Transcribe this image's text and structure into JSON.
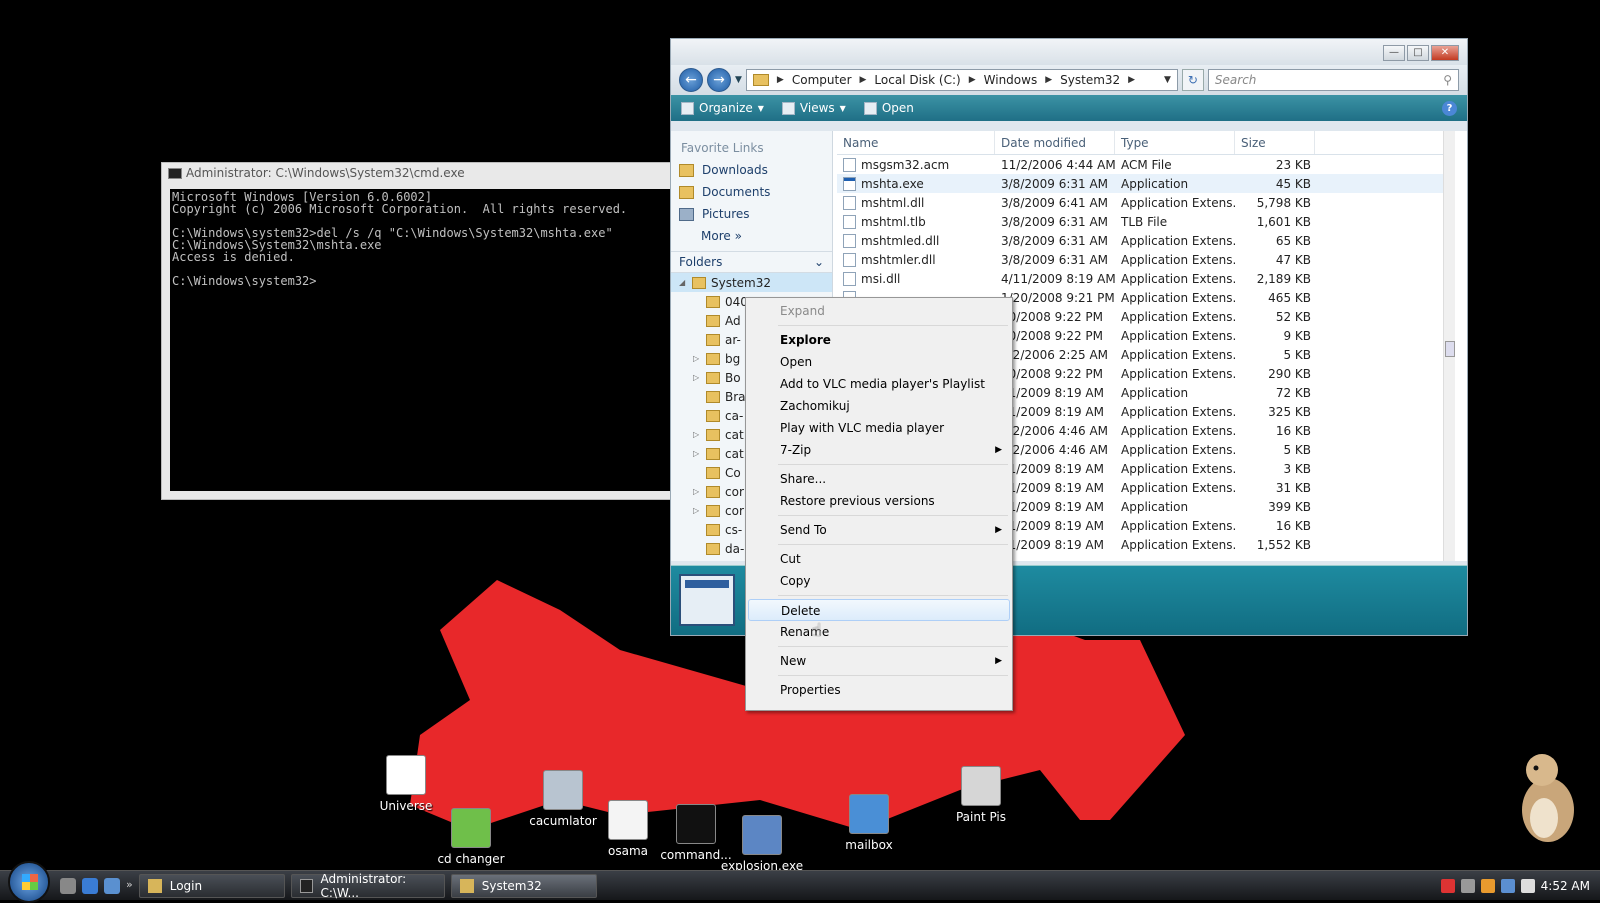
{
  "cmd": {
    "title": "Administrator: C:\\Windows\\System32\\cmd.exe",
    "lines": [
      "Microsoft Windows [Version 6.0.6002]",
      "Copyright (c) 2006 Microsoft Corporation.  All rights reserved.",
      "",
      "C:\\Windows\\system32>del /s /q \"C:\\Windows\\System32\\mshta.exe\"",
      "C:\\Windows\\System32\\mshta.exe",
      "Access is denied.",
      "",
      "C:\\Windows\\system32>"
    ]
  },
  "explorer": {
    "breadcrumb": [
      "Computer",
      "Local Disk (C:)",
      "Windows",
      "System32"
    ],
    "search_placeholder": "Search",
    "toolbar": {
      "organize": "Organize",
      "views": "Views",
      "open": "Open"
    },
    "favorites_title": "Favorite Links",
    "favorites": [
      "Downloads",
      "Documents",
      "Pictures"
    ],
    "more_label": "More",
    "folders_label": "Folders",
    "tree": [
      "System32",
      "040",
      "Ad",
      "ar-",
      "bg",
      "Bo",
      "Bra",
      "ca-",
      "cat",
      "cat",
      "Co",
      "cor",
      "cor",
      "cs-",
      "da-"
    ],
    "columns": [
      "Name",
      "Date modified",
      "Type",
      "Size"
    ],
    "files": [
      {
        "name": "msgsm32.acm",
        "date": "11/2/2006 4:44 AM",
        "type": "ACM File",
        "size": "23 KB"
      },
      {
        "name": "mshta.exe",
        "date": "3/8/2009 6:31 AM",
        "type": "Application",
        "size": "45 KB"
      },
      {
        "name": "mshtml.dll",
        "date": "3/8/2009 6:41 AM",
        "type": "Application Extens...",
        "size": "5,798 KB"
      },
      {
        "name": "mshtml.tlb",
        "date": "3/8/2009 6:31 AM",
        "type": "TLB File",
        "size": "1,601 KB"
      },
      {
        "name": "mshtmled.dll",
        "date": "3/8/2009 6:31 AM",
        "type": "Application Extens...",
        "size": "65 KB"
      },
      {
        "name": "mshtmler.dll",
        "date": "3/8/2009 6:31 AM",
        "type": "Application Extens...",
        "size": "47 KB"
      },
      {
        "name": "msi.dll",
        "date": "4/11/2009 8:19 AM",
        "type": "Application Extens...",
        "size": "2,189 KB"
      },
      {
        "name": "",
        "date": "1/20/2008 9:21 PM",
        "type": "Application Extens...",
        "size": "465 KB"
      },
      {
        "name": "",
        "date": "20/2008 9:22 PM",
        "type": "Application Extens...",
        "size": "52 KB"
      },
      {
        "name": "",
        "date": "20/2008 9:22 PM",
        "type": "Application Extens...",
        "size": "9 KB"
      },
      {
        "name": "",
        "date": "1/2/2006 2:25 AM",
        "type": "Application Extens...",
        "size": "5 KB"
      },
      {
        "name": "",
        "date": "20/2008 9:22 PM",
        "type": "Application Extens...",
        "size": "290 KB"
      },
      {
        "name": "",
        "date": "11/2009 8:19 AM",
        "type": "Application",
        "size": "72 KB"
      },
      {
        "name": "",
        "date": "11/2009 8:19 AM",
        "type": "Application Extens...",
        "size": "325 KB"
      },
      {
        "name": "",
        "date": "1/2/2006 4:46 AM",
        "type": "Application Extens...",
        "size": "16 KB"
      },
      {
        "name": "",
        "date": "1/2/2006 4:46 AM",
        "type": "Application Extens...",
        "size": "5 KB"
      },
      {
        "name": "",
        "date": "11/2009 8:19 AM",
        "type": "Application Extens...",
        "size": "3 KB"
      },
      {
        "name": "",
        "date": "11/2009 8:19 AM",
        "type": "Application Extens...",
        "size": "31 KB"
      },
      {
        "name": "",
        "date": "11/2009 8:19 AM",
        "type": "Application",
        "size": "399 KB"
      },
      {
        "name": "",
        "date": "11/2009 8:19 AM",
        "type": "Application Extens...",
        "size": "16 KB"
      },
      {
        "name": "",
        "date": "11/2009 8:19 AM",
        "type": "Application Extens...",
        "size": "1,552 KB"
      }
    ]
  },
  "context_menu": [
    {
      "label": "Expand",
      "style": "disabled"
    },
    {
      "sep": true
    },
    {
      "label": "Explore",
      "style": "bold"
    },
    {
      "label": "Open"
    },
    {
      "label": "Add to VLC media player's Playlist"
    },
    {
      "label": "Zachomikuj"
    },
    {
      "label": "Play with VLC media player"
    },
    {
      "label": "7-Zip",
      "submenu": true
    },
    {
      "sep": true
    },
    {
      "label": "Share..."
    },
    {
      "label": "Restore previous versions"
    },
    {
      "sep": true
    },
    {
      "label": "Send To",
      "submenu": true
    },
    {
      "sep": true
    },
    {
      "label": "Cut"
    },
    {
      "label": "Copy"
    },
    {
      "sep": true
    },
    {
      "label": "Delete",
      "style": "hover"
    },
    {
      "label": "Rename"
    },
    {
      "sep": true
    },
    {
      "label": "New",
      "submenu": true
    },
    {
      "sep": true
    },
    {
      "label": "Properties"
    }
  ],
  "desktop_icons": [
    {
      "label": "Universe",
      "color": "#ffffff"
    },
    {
      "label": "cd changer",
      "color": "#6fbf4a"
    },
    {
      "label": "cacumlator",
      "color": "#b8c4d0"
    },
    {
      "label": "osama",
      "color": "#f4f4f4"
    },
    {
      "label": "command...",
      "color": "#111111"
    },
    {
      "label": "explosion.exe",
      "color": "#5c86c4"
    },
    {
      "label": "mailbox",
      "color": "#4a8fd6"
    },
    {
      "label": "Paint Pis",
      "color": "#d6d6d6"
    }
  ],
  "taskbar": {
    "buttons": [
      "Login",
      "Administrator: C:\\W...",
      "System32"
    ],
    "clock": "4:52 AM"
  },
  "colors": {
    "scribble": "#e8282a",
    "toolbar": "#2a8299",
    "details": "#1a8096"
  }
}
